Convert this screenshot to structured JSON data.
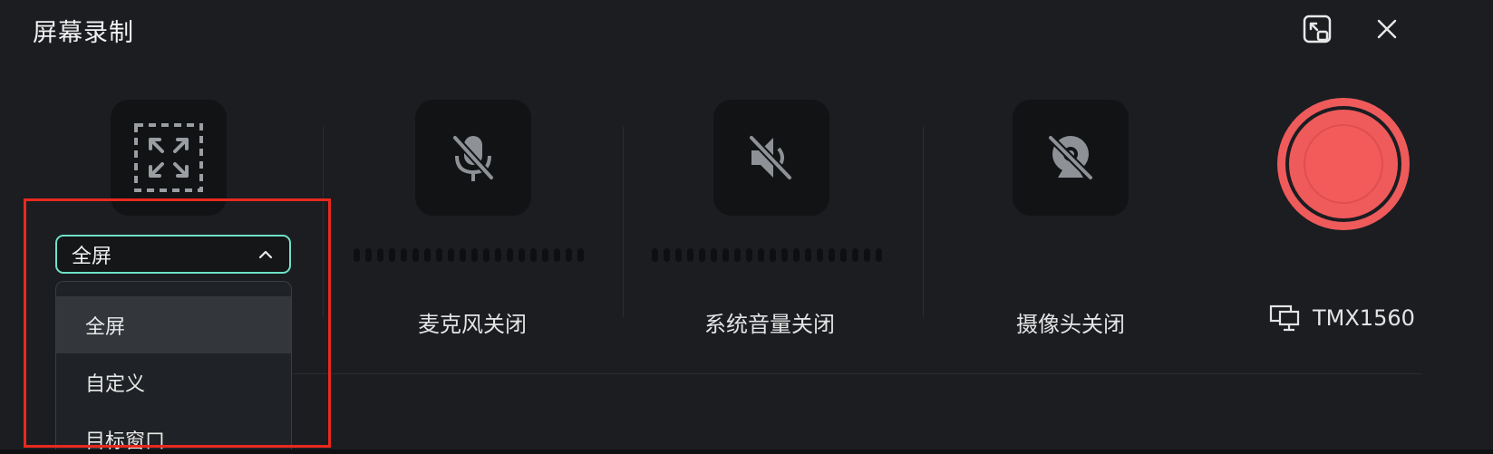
{
  "window": {
    "title": "屏幕录制"
  },
  "header": {
    "pip_icon": "picture-in-picture-icon",
    "close_icon": "close-icon"
  },
  "capture": {
    "icon": "fullscreen-expand-icon",
    "select_value": "全屏",
    "options": [
      "全屏",
      "自定义",
      "目标窗口"
    ],
    "selected_index": 0
  },
  "microphone": {
    "icon": "mic-off-icon",
    "label": "麦克风关闭",
    "level": 0
  },
  "system_audio": {
    "icon": "speaker-off-icon",
    "label": "系统音量关闭",
    "level": 0
  },
  "camera": {
    "icon": "camera-off-icon",
    "label": "摄像头关闭"
  },
  "record": {
    "icon": "record-button-icon",
    "color": "#ef5b5b"
  },
  "display": {
    "icon": "monitor-icon",
    "name": "TMX1560"
  },
  "colors": {
    "background": "#1b1d21",
    "tile": "#111315",
    "accent_border": "#6ee0c8",
    "record": "#ef5b5b",
    "highlight": "#e8291e"
  }
}
